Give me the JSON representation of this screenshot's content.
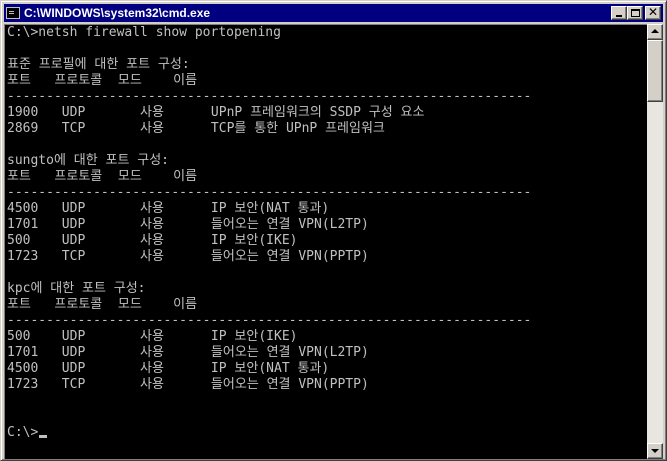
{
  "window": {
    "title": "C:\\WINDOWS\\system32\\cmd.exe",
    "icon": "console-icon",
    "buttons": {
      "minimize": "minimize-icon",
      "maximize": "maximize-icon",
      "close": "✕"
    }
  },
  "colors": {
    "titlebar": "#000080",
    "console_bg": "#000000",
    "console_fg": "#c0c0c0",
    "chrome": "#d4d0c8"
  },
  "console": {
    "prompt": "C:\\>",
    "lines": [
      "C:\\>netsh firewall show portopening",
      "",
      "표준 프로필에 대한 포트 구성:",
      "포트   프로토콜  모드    이름",
      "-------------------------------------------------------------------",
      "1900   UDP       사용      UPnP 프레임워크의 SSDP 구성 요소",
      "2869   TCP       사용      TCP를 통한 UPnP 프레임워크",
      "",
      "sungto에 대한 포트 구성:",
      "포트   프로토콜  모드    이름",
      "-------------------------------------------------------------------",
      "4500   UDP       사용      IP 보안(NAT 통과)",
      "1701   UDP       사용      들어오는 연결 VPN(L2TP)",
      "500    UDP       사용      IP 보안(IKE)",
      "1723   TCP       사용      들어오는 연결 VPN(PPTP)",
      "",
      "kpc에 대한 포트 구성:",
      "포트   프로토콜  모드    이름",
      "-------------------------------------------------------------------",
      "500    UDP       사용      IP 보안(IKE)",
      "1701   UDP       사용      들어오는 연결 VPN(L2TP)",
      "4500   UDP       사용      IP 보안(NAT 통과)",
      "1723   TCP       사용      들어오는 연결 VPN(PPTP)",
      "",
      "",
      "C:\\>"
    ]
  },
  "scrollbar": {
    "up_icon": "scroll-up-arrow-icon",
    "down_icon": "scroll-down-arrow-icon"
  }
}
